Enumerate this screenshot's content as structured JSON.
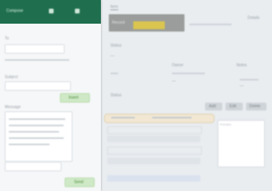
{
  "left_panel": {
    "header": {
      "title": "Compose",
      "icons": [
        "minimize-icon",
        "close-icon"
      ]
    },
    "fields": [
      {
        "label": "To",
        "value": ""
      },
      {
        "label": "Subject",
        "value": ""
      }
    ],
    "body_label": "Message",
    "send_button": "Send",
    "insert_button": "Insert"
  },
  "right_panel": {
    "tabs": [
      "Item",
      "Details"
    ],
    "toolbar": {
      "title": "Record"
    },
    "section_labels": [
      "Status",
      "Owner",
      "Notes"
    ],
    "value_labels": [
      "—",
      "—",
      "—"
    ],
    "buttons": [
      "Add",
      "Edit",
      "Delete"
    ],
    "table_rows": [
      {
        "col1": "",
        "col2": ""
      },
      {
        "col1": "",
        "col2": ""
      },
      {
        "col1": "",
        "col2": ""
      },
      {
        "col1": "",
        "col2": ""
      },
      {
        "col1": "",
        "col2": ""
      }
    ],
    "preview_label": "Preview"
  }
}
